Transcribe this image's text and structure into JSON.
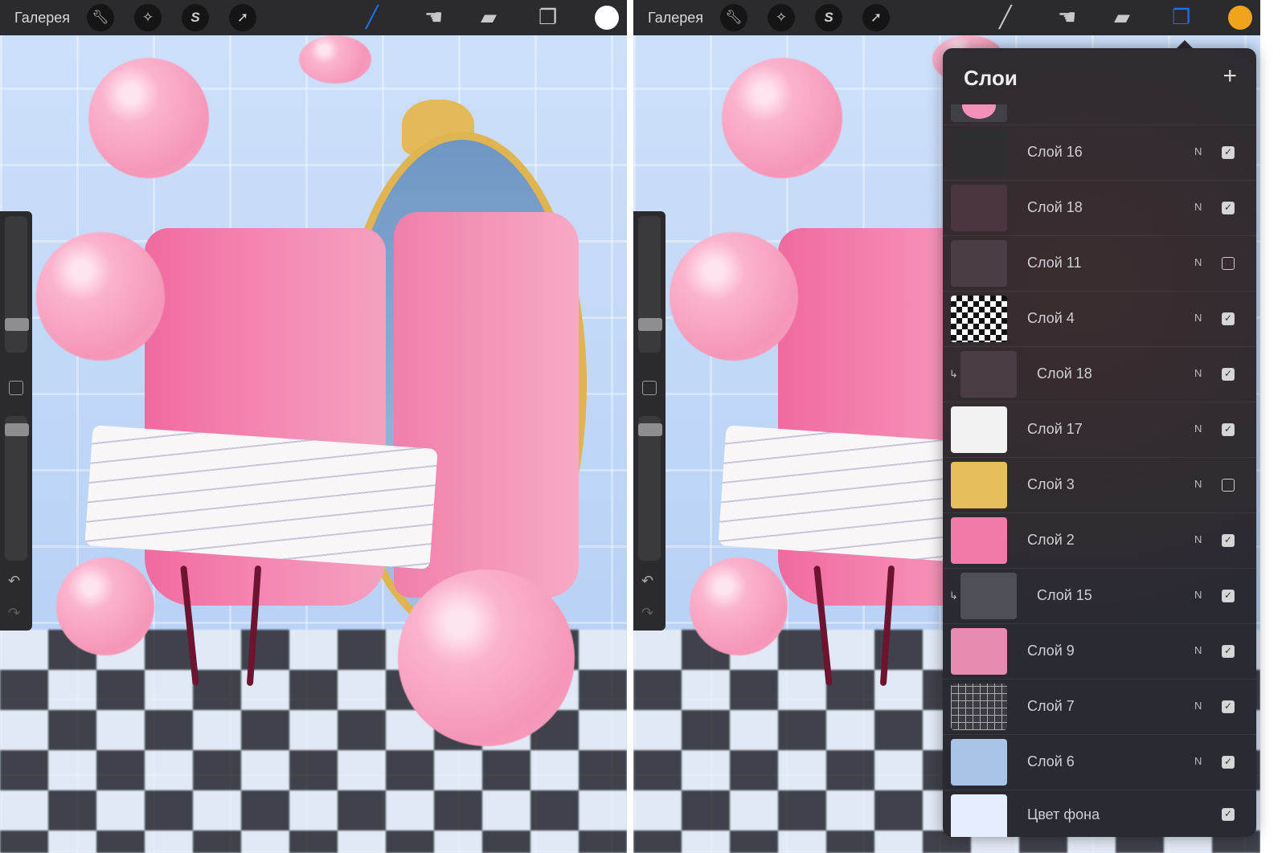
{
  "toolbar": {
    "gallery": "Галерея",
    "icons": [
      "wrench-icon",
      "magic-wand-icon",
      "selection-icon",
      "transform-arrow-icon"
    ],
    "tools": [
      "brush-icon",
      "smudge-icon",
      "eraser-icon",
      "layers-icon"
    ]
  },
  "screens": [
    {
      "active_tool": "brush",
      "color": "#ffffff"
    },
    {
      "active_tool": "layers",
      "color": "#f0a41b"
    }
  ],
  "accent": "#1a73e8",
  "layers_panel": {
    "title": "Слои",
    "add": "+",
    "layers": [
      {
        "name": "Слой 16",
        "blend": "N",
        "visible": true,
        "clipped": false,
        "thumb": "#2e2e32"
      },
      {
        "name": "Слой 18",
        "blend": "N",
        "visible": true,
        "clipped": false,
        "thumb": "#4b3540"
      },
      {
        "name": "Слой 11",
        "blend": "N",
        "visible": false,
        "clipped": false,
        "thumb": "#4a3d45"
      },
      {
        "name": "Слой 4",
        "blend": "N",
        "visible": true,
        "clipped": false,
        "thumb": "checker"
      },
      {
        "name": "Слой 18",
        "blend": "N",
        "visible": true,
        "clipped": true,
        "thumb": "#4a3d45"
      },
      {
        "name": "Слой 17",
        "blend": "N",
        "visible": true,
        "clipped": false,
        "thumb": "#f2f2f2"
      },
      {
        "name": "Слой 3",
        "blend": "N",
        "visible": false,
        "clipped": false,
        "thumb": "#e4bf5a"
      },
      {
        "name": "Слой 2",
        "blend": "N",
        "visible": true,
        "clipped": false,
        "thumb": "#f27aa8"
      },
      {
        "name": "Слой 15",
        "blend": "N",
        "visible": true,
        "clipped": true,
        "thumb": "#4e5058"
      },
      {
        "name": "Слой 9",
        "blend": "N",
        "visible": true,
        "clipped": false,
        "thumb": "#e68bb0"
      },
      {
        "name": "Слой 7",
        "blend": "N",
        "visible": true,
        "clipped": false,
        "thumb": "grid"
      },
      {
        "name": "Слой 6",
        "blend": "N",
        "visible": true,
        "clipped": false,
        "thumb": "#a9c4e6"
      }
    ],
    "background": {
      "name": "Цвет фона",
      "visible": true
    }
  }
}
